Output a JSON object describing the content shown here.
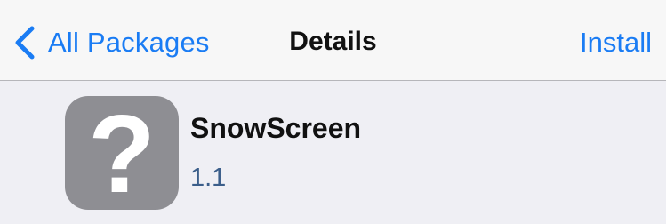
{
  "navbar": {
    "back_label": "All Packages",
    "title": "Details",
    "action_label": "Install"
  },
  "package": {
    "icon_glyph": "?",
    "icon_name": "question-mark-icon",
    "name": "SnowScreen",
    "version": "1.1"
  },
  "colors": {
    "accent": "#1a7cf4",
    "navbar_bg": "#f7f7f7",
    "content_bg": "#efeff4",
    "icon_bg": "#8e8e93",
    "version_text": "#3b5e8a"
  }
}
